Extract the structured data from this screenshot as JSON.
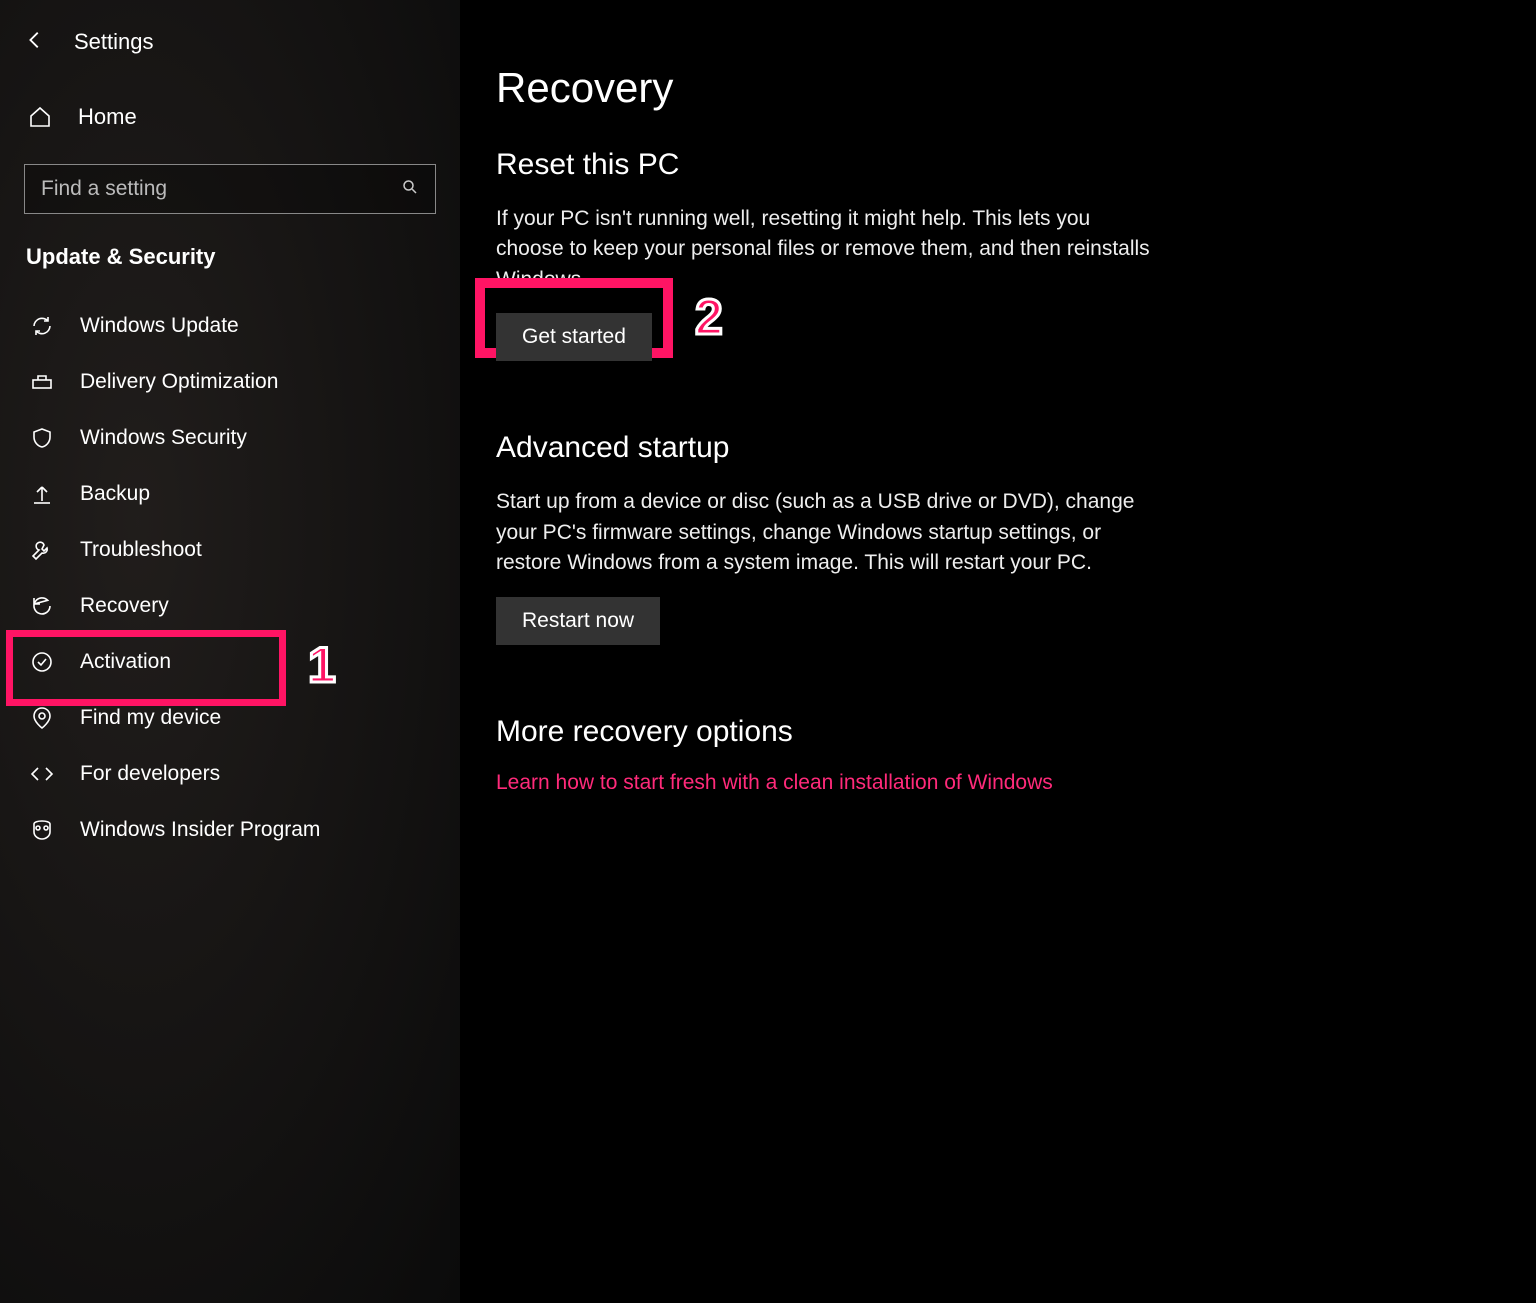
{
  "header": {
    "title": "Settings"
  },
  "home": {
    "label": "Home"
  },
  "search": {
    "placeholder": "Find a setting"
  },
  "category": {
    "label": "Update & Security"
  },
  "nav": {
    "items": [
      {
        "label": "Windows Update"
      },
      {
        "label": "Delivery Optimization"
      },
      {
        "label": "Windows Security"
      },
      {
        "label": "Backup"
      },
      {
        "label": "Troubleshoot"
      },
      {
        "label": "Recovery"
      },
      {
        "label": "Activation"
      },
      {
        "label": "Find my device"
      },
      {
        "label": "For developers"
      },
      {
        "label": "Windows Insider Program"
      }
    ]
  },
  "main": {
    "title": "Recovery",
    "reset": {
      "heading": "Reset this PC",
      "desc": "If your PC isn't running well, resetting it might help. This lets you choose to keep your personal files or remove them, and then reinstalls Windows.",
      "button": "Get started"
    },
    "advanced": {
      "heading": "Advanced startup",
      "desc": "Start up from a device or disc (such as a USB drive or DVD), change your PC's firmware settings, change Windows startup settings, or restore Windows from a system image. This will restart your PC.",
      "button": "Restart now"
    },
    "more": {
      "heading": "More recovery options",
      "link": "Learn how to start fresh with a clean installation of Windows"
    }
  },
  "annotations": {
    "one": "1",
    "two": "2"
  }
}
